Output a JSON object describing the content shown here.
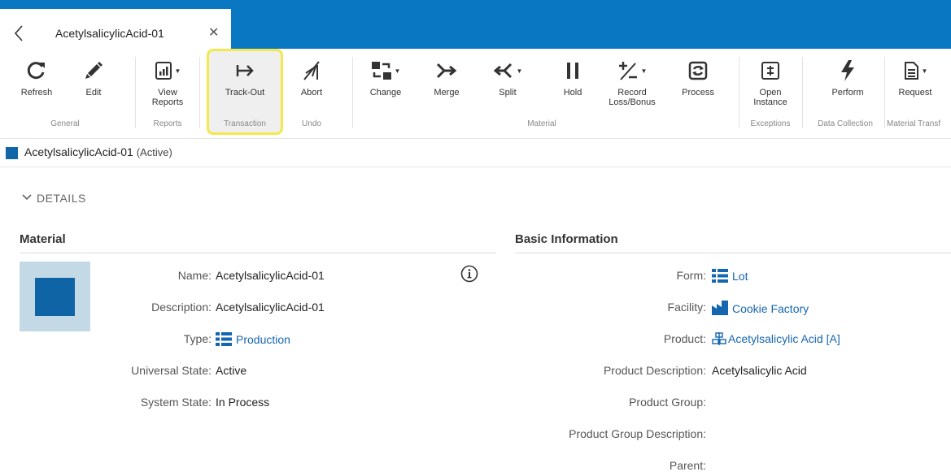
{
  "tab": {
    "title": "AcetylsalicylicAcid-01",
    "close": "✕"
  },
  "ribbon": {
    "buttons": {
      "refresh": "Refresh",
      "edit": "Edit",
      "view_reports_1": "View",
      "view_reports_2": "Reports",
      "track_out": "Track-Out",
      "abort": "Abort",
      "change": "Change",
      "merge": "Merge",
      "split": "Split",
      "hold": "Hold",
      "record_1": "Record",
      "record_2": "Loss/Bonus",
      "process": "Process",
      "open_instance_1": "Open",
      "open_instance_2": "Instance",
      "perform": "Perform",
      "request": "Request"
    },
    "groups": {
      "general": "General",
      "reports": "Reports",
      "transaction": "Transaction",
      "undo": "Undo",
      "material": "Material",
      "exceptions": "Exceptions",
      "data_collection": "Data Collection",
      "material_transfer": "Material Transf"
    }
  },
  "header": {
    "name": "AcetylsalicylicAcid-01",
    "state": "(Active)"
  },
  "details": {
    "toggle": "DETAILS",
    "material": {
      "title": "Material",
      "fields": {
        "name_label": "Name:",
        "name_value": "AcetylsalicylicAcid-01",
        "description_label": "Description:",
        "description_value": "AcetylsalicylicAcid-01",
        "type_label": "Type:",
        "type_value": "Production",
        "universal_state_label": "Universal State:",
        "universal_state_value": "Active",
        "system_state_label": "System State:",
        "system_state_value": "In Process"
      }
    },
    "basic": {
      "title": "Basic Information",
      "fields": {
        "form_label": "Form:",
        "form_value": "Lot",
        "facility_label": "Facility:",
        "facility_value": "Cookie Factory",
        "product_label": "Product:",
        "product_value": "Acetylsalicylic Acid [A]",
        "product_description_label": "Product Description:",
        "product_description_value": "Acetylsalicylic Acid",
        "product_group_label": "Product Group:",
        "product_group_description_label": "Product Group Description:",
        "parent_label": "Parent:"
      }
    }
  },
  "colors": {
    "brand_blue": "#0a77c2",
    "material_square": "#0f64a5",
    "highlight": "#f5e84a",
    "link": "#1566b0"
  }
}
